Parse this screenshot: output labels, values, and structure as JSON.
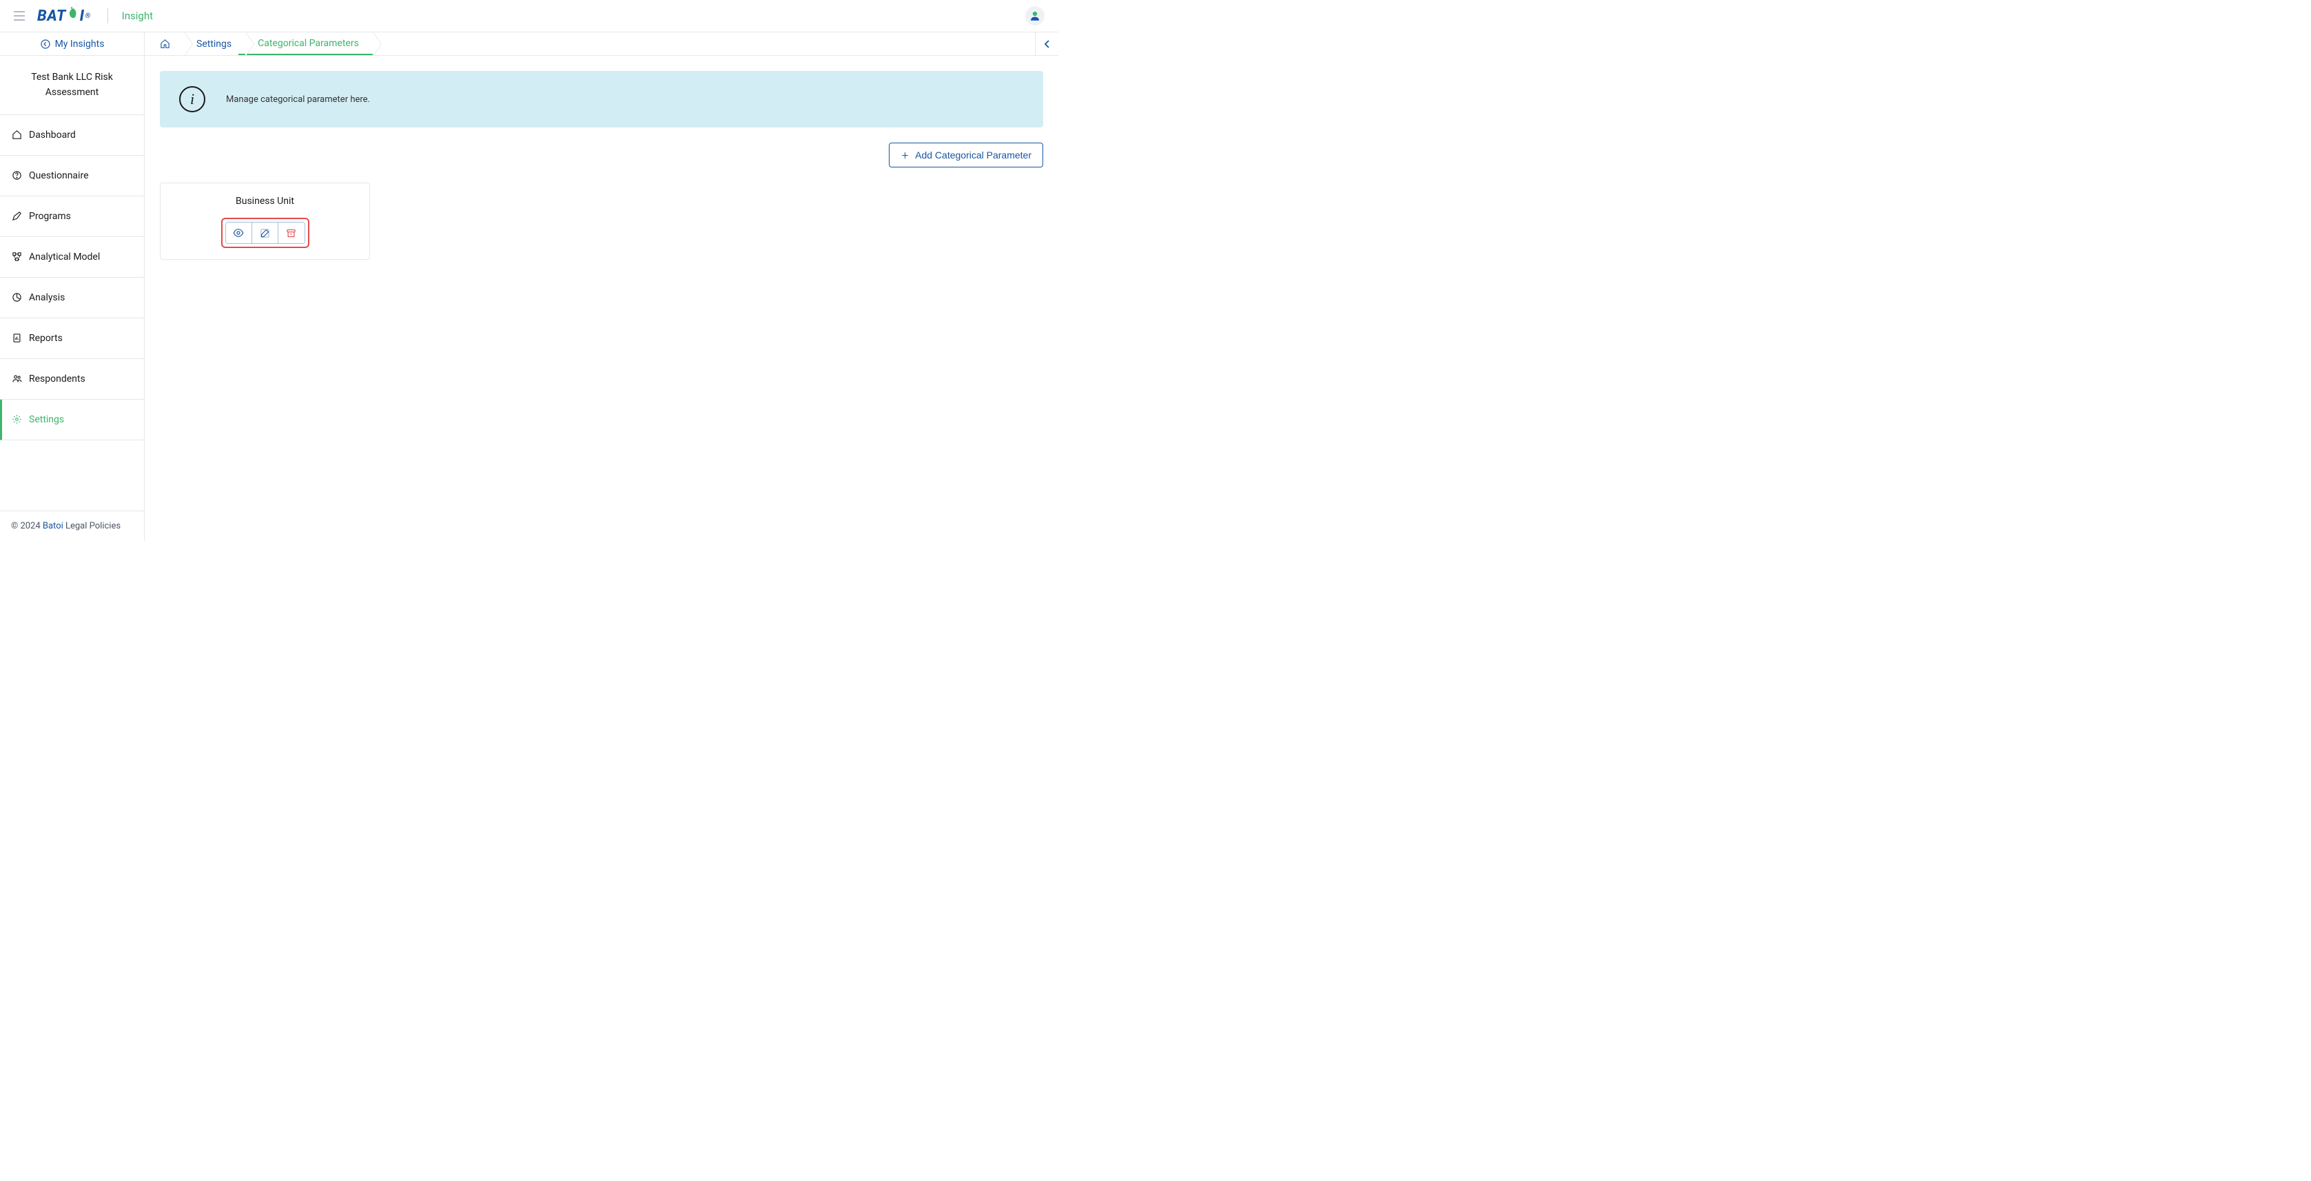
{
  "header": {
    "logo_part1": "BAT",
    "logo_part2": "I",
    "logo_reg": "®",
    "app_name": "Insight"
  },
  "sidebar": {
    "my_insights_label": "My Insights",
    "project_title": "Test Bank LLC Risk Assessment",
    "nav": [
      {
        "label": "Dashboard",
        "active": false
      },
      {
        "label": "Questionnaire",
        "active": false
      },
      {
        "label": "Programs",
        "active": false
      },
      {
        "label": "Analytical Model",
        "active": false
      },
      {
        "label": "Analysis",
        "active": false
      },
      {
        "label": "Reports",
        "active": false
      },
      {
        "label": "Respondents",
        "active": false
      },
      {
        "label": "Settings",
        "active": true
      }
    ],
    "footer": {
      "copyright_prefix": "© 2024 ",
      "brand": "Batoi",
      "legal": " Legal Policies"
    }
  },
  "breadcrumb": {
    "items": [
      {
        "label": "Settings",
        "active": false
      },
      {
        "label": "Categorical Parameters",
        "active": true
      }
    ]
  },
  "banner": {
    "text": "Manage categorical parameter here."
  },
  "actions": {
    "add_label": "Add Categorical Parameter"
  },
  "cards": [
    {
      "title": "Business Unit"
    }
  ]
}
